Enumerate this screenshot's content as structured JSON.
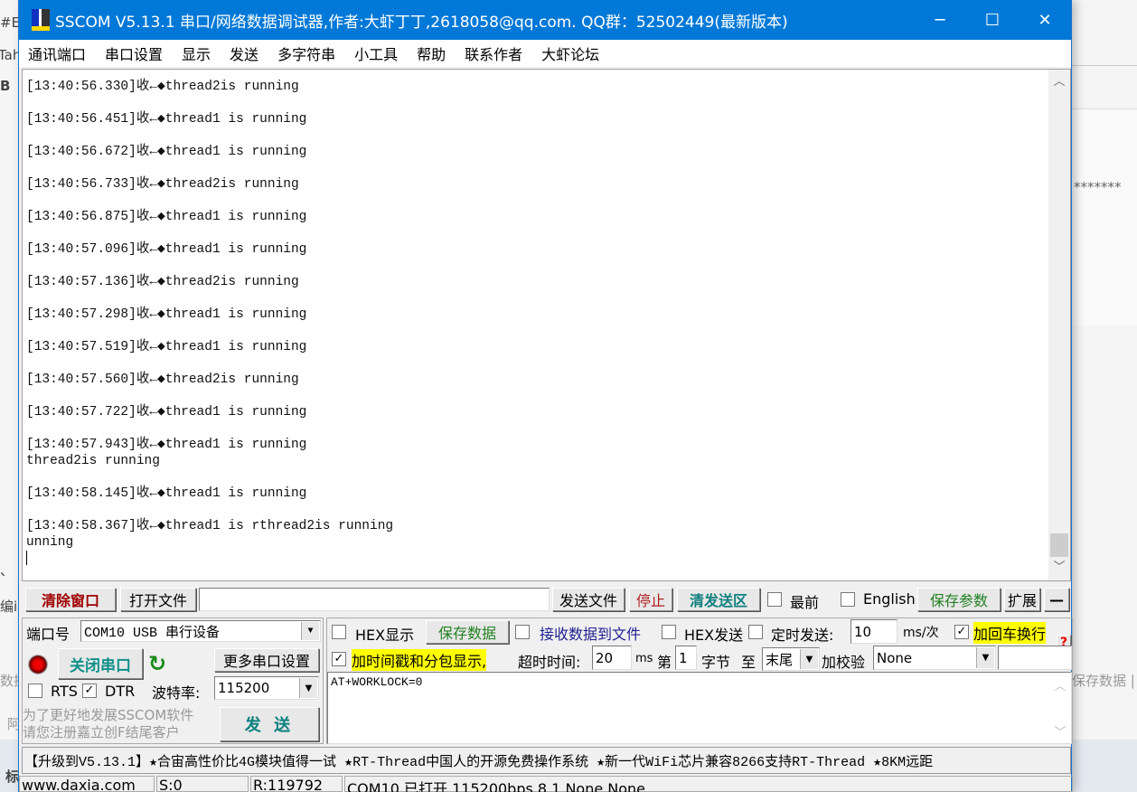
{
  "background": {
    "fragments": [
      "#E",
      "Tah",
      "B",
      "*******",
      "、",
      "编i",
      "数据",
      "阿",
      "标",
      "保存数据 |"
    ]
  },
  "window": {
    "title": "SSCOM V5.13.1 串口/网络数据调试器,作者:大虾丁丁,2618058@qq.com. QQ群：52502449(最新版本)",
    "controls": [
      "─",
      "☐",
      "✕"
    ]
  },
  "menu": [
    "通讯端口",
    "串口设置",
    "显示",
    "发送",
    "多字符串",
    "小工具",
    "帮助",
    "联系作者",
    "大虾论坛"
  ],
  "log": [
    "[13:40:56.330]收←◆thread2is running",
    "[13:40:56.451]收←◆thread1 is running",
    "[13:40:56.672]收←◆thread1 is running",
    "[13:40:56.733]收←◆thread2is running",
    "[13:40:56.875]收←◆thread1 is running",
    "[13:40:57.096]收←◆thread1 is running",
    "[13:40:57.136]收←◆thread2is running",
    "[13:40:57.298]收←◆thread1 is running",
    "[13:40:57.519]收←◆thread1 is running",
    "[13:40:57.560]收←◆thread2is running",
    "[13:40:57.722]收←◆thread1 is running",
    "[13:40:57.943]收←◆thread1 is running\nthread2is running",
    "[13:40:58.145]收←◆thread1 is running",
    "[13:40:58.367]收←◆thread1 is rthread2is running\nunning"
  ],
  "toolbar": {
    "clear": "清除窗口",
    "open_file": "打开文件",
    "file_path": "",
    "send_file": "发送文件",
    "stop": "停止",
    "clear_send": "清发送区",
    "topmost": "最前",
    "english": "English",
    "save_params": "保存参数",
    "expand": "扩展",
    "collapse": "—"
  },
  "port": {
    "label": "端口号",
    "value": "COM10 USB 串行设备",
    "close_btn": "关闭串口",
    "more": "更多串口设置",
    "rts": "RTS",
    "dtr": "DTR",
    "baud_label": "波特率:",
    "baud": "115200",
    "rts_checked": false,
    "dtr_checked": true
  },
  "promo": {
    "line1": "为了更好地发展SSCOM软件",
    "line2": "请您注册嘉立创F结尾客户"
  },
  "send_btn": "发 送",
  "options": {
    "hex_display": "HEX显示",
    "save_data": "保存数据",
    "recv_to_file": "接收数据到文件",
    "hex_send": "HEX发送",
    "timed_send": "定时发送:",
    "interval": "10",
    "interval_unit": "ms/次",
    "add_crlf": "加回车换行",
    "timestamp": "加时间戳和分包显示,",
    "timeout_label": "超时时间:",
    "timeout": "20",
    "timeout_unit": "ms",
    "byte_prefix": "第",
    "byte_from": "1",
    "byte_label": "字节",
    "to": "至",
    "to_value": "末尾",
    "checksum_label": "加校验",
    "checksum": "None",
    "help": "?"
  },
  "send_text": "AT+WORKLOCK=0",
  "marquee": "【升级到V5.13.1】★合宙高性价比4G模块值得一试 ★RT-Thread中国人的开源免费操作系统 ★新一代WiFi芯片兼容8266支持RT-Thread ★8KM远距",
  "status": {
    "site": "www.daxia.com",
    "sent": "S:0",
    "recv": "R:119792",
    "port_state": "COM10 已打开  115200bps,8,1,None,None"
  }
}
